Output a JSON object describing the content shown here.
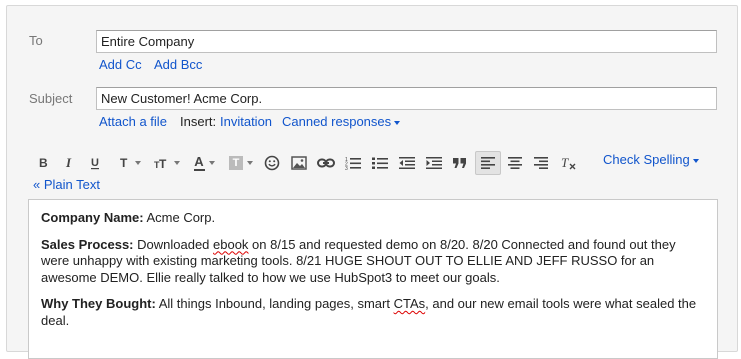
{
  "to": {
    "label": "To",
    "value": "Entire Company"
  },
  "cc_bcc": {
    "add_cc": "Add Cc",
    "add_bcc": "Add Bcc"
  },
  "subject": {
    "label": "Subject",
    "value": "New Customer! Acme Corp."
  },
  "attachments": {
    "attach_file": "Attach a file",
    "insert_label": "Insert:",
    "invitation": "Invitation",
    "canned_responses": "Canned responses"
  },
  "toolbar": {
    "text_color_letter": "A",
    "background_color_letter": "T",
    "font_letter": "T",
    "check_spelling": "Check Spelling",
    "plain_text": "« Plain Text"
  },
  "body": {
    "p1_label": "Company Name:",
    "p1_text": " Acme Corp.",
    "p2_label": "Sales Process:",
    "p2_a": " Downloaded ",
    "p2_misspell": "ebook",
    "p2_b": " on 8/15 and requested demo on 8/20. 8/20 Connected and found out they were unhappy with existing marketing tools. 8/21 HUGE SHOUT OUT TO ELLIE AND JEFF RUSSO for an awesome DEMO. Ellie really talked to how we use HubSpot3 to meet our goals.",
    "p3_label": "Why They Bought:",
    "p3_a": " All things Inbound, landing pages, smart ",
    "p3_misspell": "CTAs",
    "p3_b": ", and our new email tools were what sealed the deal."
  },
  "colors": {
    "link": "#1155cc",
    "label": "#777777",
    "panel": "#f5f5f5"
  }
}
